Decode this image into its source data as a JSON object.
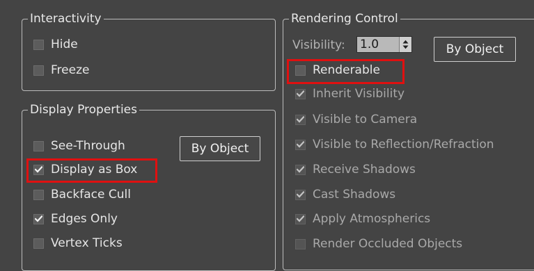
{
  "interactivity": {
    "title": "Interactivity",
    "items": [
      {
        "label": "Hide",
        "checked": false
      },
      {
        "label": "Freeze",
        "checked": false
      }
    ]
  },
  "display_properties": {
    "title": "Display Properties",
    "by_object_label": "By Object",
    "items": [
      {
        "label": "See-Through",
        "checked": false
      },
      {
        "label": "Display as Box",
        "checked": true
      },
      {
        "label": "Backface Cull",
        "checked": false
      },
      {
        "label": "Edges Only",
        "checked": true
      },
      {
        "label": "Vertex Ticks",
        "checked": false
      }
    ]
  },
  "rendering_control": {
    "title": "Rendering Control",
    "visibility_label": "Visibility:",
    "visibility_value": "1.0",
    "by_object_label": "By Object",
    "items": [
      {
        "label": "Renderable",
        "checked": false
      },
      {
        "label": "Inherit Visibility",
        "checked": true
      },
      {
        "label": "Visible to Camera",
        "checked": true
      },
      {
        "label": "Visible to Reflection/Refraction",
        "checked": true
      },
      {
        "label": "Receive Shadows",
        "checked": true
      },
      {
        "label": "Cast Shadows",
        "checked": true
      },
      {
        "label": "Apply Atmospherics",
        "checked": true
      },
      {
        "label": "Render Occluded Objects",
        "checked": false
      }
    ]
  },
  "colors": {
    "background": "#444444",
    "highlight": "#e01010"
  }
}
